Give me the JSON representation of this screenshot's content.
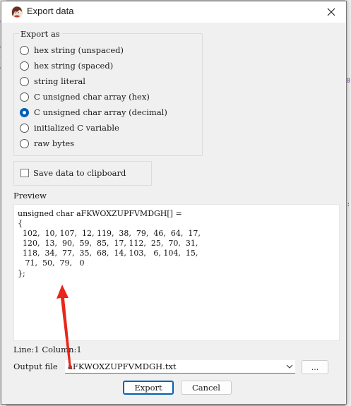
{
  "window": {
    "title": "Export data",
    "close_icon": "close-icon",
    "app_icon": "app-avatar-icon"
  },
  "export_as": {
    "title": "Export as",
    "options": [
      {
        "label": "hex string (unspaced)",
        "checked": false
      },
      {
        "label": "hex string (spaced)",
        "checked": false
      },
      {
        "label": "string literal",
        "checked": false
      },
      {
        "label": "C unsigned char array (hex)",
        "checked": false
      },
      {
        "label": "C unsigned char array (decimal)",
        "checked": true
      },
      {
        "label": "initialized C variable",
        "checked": false
      },
      {
        "label": "raw bytes",
        "checked": false
      }
    ]
  },
  "clipboard": {
    "label": "Save data to clipboard",
    "checked": false
  },
  "preview": {
    "label": "Preview",
    "text": "unsigned char aFKWOXZUPFVMDGH[] =\n{\n  102,  10, 107,  12, 119,  38,  79,  46,  64,  17,\n  120,  13,  90,  59,  85,  17, 112,  25,  70,  31,\n  118,  34,  77,  35,  68,  14, 103,   6, 104,  15,\n   71,  50,  79,   0\n};"
  },
  "status": {
    "line_col": "Line:1  Column:1"
  },
  "output": {
    "label": "Output file",
    "value": "aFKWOXZUPFVMDGH.txt",
    "browse_label": "..."
  },
  "buttons": {
    "export": "Export",
    "cancel": "Cancel"
  },
  "colors": {
    "accent": "#005fb8",
    "annotation_arrow": "#e8261c"
  }
}
